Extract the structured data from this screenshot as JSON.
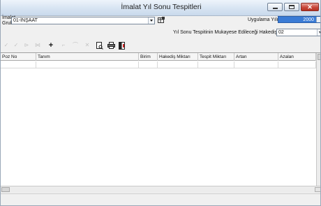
{
  "window": {
    "title": "İmalat Yıl Sonu Tespitleri"
  },
  "form": {
    "imalat_grubu_label_1": "İmalat",
    "imalat_grubu_label_2": "Grubu",
    "imalat_grubu_value": "01-İNŞAAT",
    "uygulama_yili_label": "Uygulama Yılı",
    "uygulama_yili_value": "2000",
    "hakedis_label": "Yıl Sonu Tespitinin Mukayese Edileceği Hakediş No",
    "hakedis_value": "02"
  },
  "toolbar": {
    "icons": [
      "check-icon",
      "check-icon",
      "first-icon",
      "prev-icon",
      "add-icon",
      "undo-icon",
      "redo-icon",
      "delete-icon",
      "preview-icon",
      "print-icon",
      "export-icon"
    ]
  },
  "table": {
    "columns": [
      "Poz No",
      "Tanım",
      "Birim",
      "Hakediş Miktarı",
      "Tespit Miktarı",
      "Artan",
      "Azalan"
    ],
    "rows": []
  }
}
